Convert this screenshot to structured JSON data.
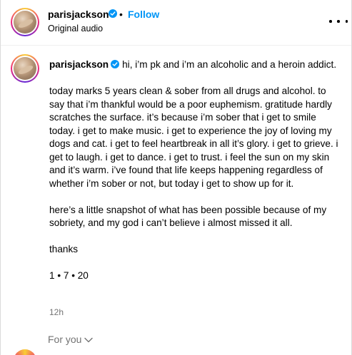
{
  "header": {
    "username": "parisjackson",
    "separator": "•",
    "follow_label": "Follow",
    "audio": "Original audio",
    "more_icon": "more-horizontal-icon"
  },
  "caption": {
    "username": "parisjackson",
    "first_line": "hi, i’m pk and i’m an alcoholic and a heroin addict.",
    "paragraph_1": "today marks 5 years clean & sober from all drugs and alcohol. to say that i’m thankful would be a poor euphemism. gratitude hardly scratches the surface. it’s because i’m sober that i get to smile today. i get to make music. i get to experience the joy of loving my dogs and cat. i get to feel heartbreak in all it’s glory. i get to grieve. i get to laugh. i get to dance. i get to trust. i feel the sun on my skin and it’s warm. i’ve found that life keeps happening regardless of whether i’m sober or not, but today i get to show up for it.",
    "paragraph_2": "here’s a little snapshot of what has been possible because of my sobriety, and my god i can’t believe i almost missed it all.",
    "paragraph_3": "thanks",
    "paragraph_4": "1 • 7 • 20"
  },
  "timestamp": "12h",
  "feed_filter": {
    "label": "For you",
    "icon": "chevron-down-icon"
  },
  "colors": {
    "accent": "#0095f6",
    "muted": "#737373",
    "border": "#dbdbdb"
  }
}
